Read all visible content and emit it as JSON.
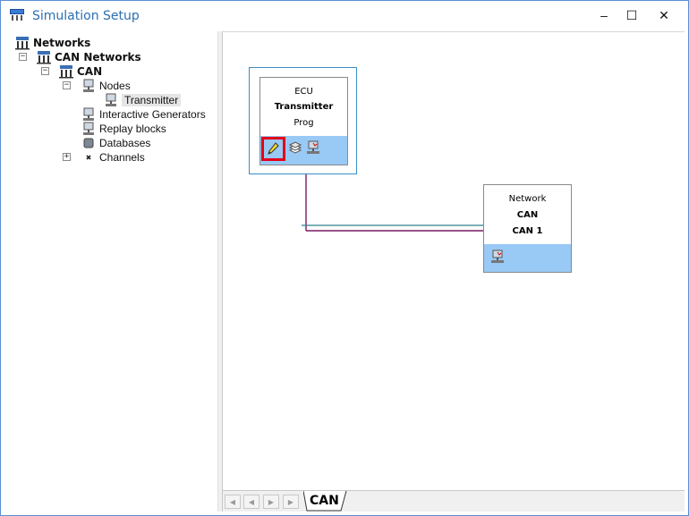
{
  "window": {
    "title": "Simulation Setup",
    "controls": {
      "minimize": "–",
      "maximize": "☐",
      "close": "✕"
    }
  },
  "tree": {
    "items": [
      {
        "label": "Networks",
        "icon": "network-icon"
      },
      {
        "label": "CAN Networks",
        "icon": "network-icon"
      },
      {
        "label": "CAN",
        "icon": "network-icon"
      },
      {
        "label": "Nodes",
        "icon": "node-icon"
      },
      {
        "label": "Transmitter",
        "icon": "node-icon"
      },
      {
        "label": "Interactive Generators",
        "icon": "node-icon"
      },
      {
        "label": "Replay blocks",
        "icon": "node-icon"
      },
      {
        "label": "Databases",
        "icon": "database-icon"
      },
      {
        "label": "Channels",
        "icon": "channel-icon"
      }
    ]
  },
  "canvas": {
    "ecu": {
      "type": "ECU",
      "name": "Transmitter",
      "program": "Prog"
    },
    "network": {
      "type": "Network",
      "name": "CAN",
      "channel": "CAN 1"
    }
  },
  "tabs": {
    "active": "CAN"
  },
  "colors": {
    "accent": "#2a6fb0",
    "block_bar": "#99c9f5",
    "highlight": "#e4001b",
    "bus_line": "#7a1a63",
    "bus_line2": "#2f7f8e"
  }
}
